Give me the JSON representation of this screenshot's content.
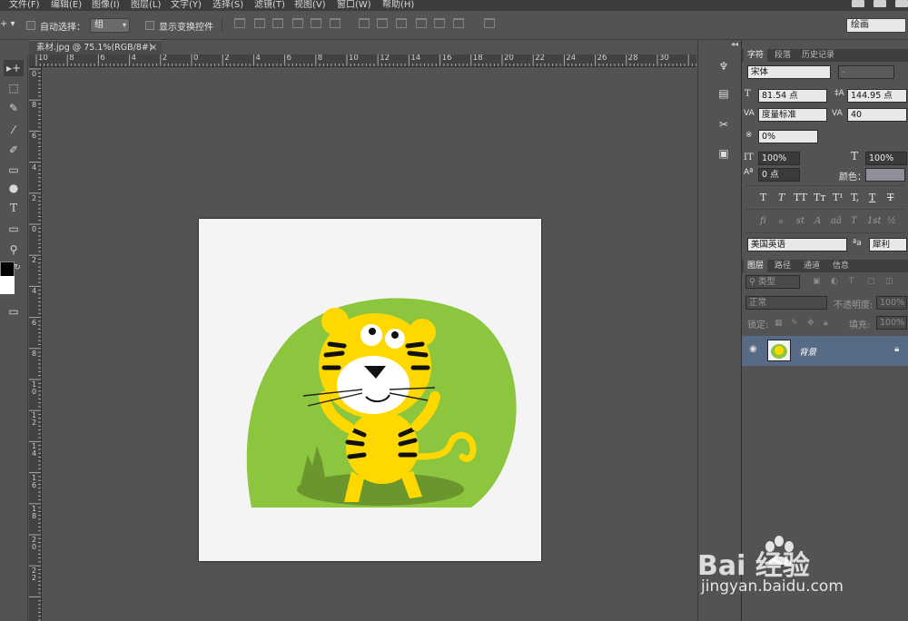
{
  "menu": [
    "文件(F)",
    "编辑(E)",
    "图像(I)",
    "图层(L)",
    "文字(Y)",
    "选择(S)",
    "滤镜(T)",
    "视图(V)",
    "窗口(W)",
    "帮助(H)"
  ],
  "options": {
    "auto_select_label": "自动选择：",
    "auto_select_value": "组",
    "show_transform_label": "显示变换控件",
    "workspace": "绘画"
  },
  "document": {
    "tab_title": "素材.jpg @ 75.1%(RGB/8#)",
    "close_glyph": "×"
  },
  "ruler": {
    "h_labels": [
      "10",
      "8",
      "6",
      "4",
      "2",
      "0",
      "2",
      "4",
      "6",
      "8",
      "10",
      "12",
      "14",
      "16",
      "18",
      "20",
      "22",
      "24",
      "26",
      "28",
      "30"
    ],
    "v_labels": [
      "0",
      "8",
      "6",
      "4",
      "2",
      "0",
      "2",
      "4",
      "6",
      "8",
      "1 0",
      "1 2",
      "1 4",
      "1 6",
      "1 8",
      "2 0",
      "2 2"
    ]
  },
  "tools": [
    "move-tool",
    "marquee-tool",
    "eyedropper-tool",
    "brush-tool",
    "history-brush-tool",
    "gradient-tool",
    "dodge-tool",
    "type-tool",
    "shape-tool",
    "zoom-tool",
    "swap-colors-tool",
    "screen-mode-tool"
  ],
  "char_panel": {
    "tabs": [
      "字符",
      "段落",
      "历史记录"
    ],
    "font_family": "宋体",
    "font_style": "-",
    "size": "81.54 点",
    "leading": "144.95 点",
    "kerning": "度量标准",
    "tracking": "40",
    "scale_pct": "0%",
    "vscale": "100%",
    "hscale": "100%",
    "baseline": "0 点",
    "color_label": "颜色：",
    "style_buttons": [
      "T",
      "T",
      "TT",
      "Tт",
      "T¹",
      "T,",
      "T",
      "T"
    ],
    "ot_buttons": [
      "fi",
      "ℴ",
      "st",
      "A",
      "aā",
      "T",
      "1st",
      "½"
    ],
    "language": "美国英语",
    "aa_label": "ªa",
    "aa_mode": "犀利"
  },
  "layers_panel": {
    "tabs": [
      "图层",
      "路径",
      "通道",
      "信息"
    ],
    "kind_filter": "类型",
    "blend_mode": "正常",
    "opacity_label": "不透明度:",
    "opacity_value": "100%",
    "lock_label": "锁定:",
    "fill_label": "填充:",
    "fill_value": "100%",
    "layer_name": "背景"
  },
  "watermark": {
    "line1": "Bai   经验",
    "line2": "jingyan.baidu.com"
  },
  "colors": {
    "accent_layer_row": "#576a86",
    "tiger_yellow": "#ffd800",
    "blob_green": "#8cc63f"
  }
}
